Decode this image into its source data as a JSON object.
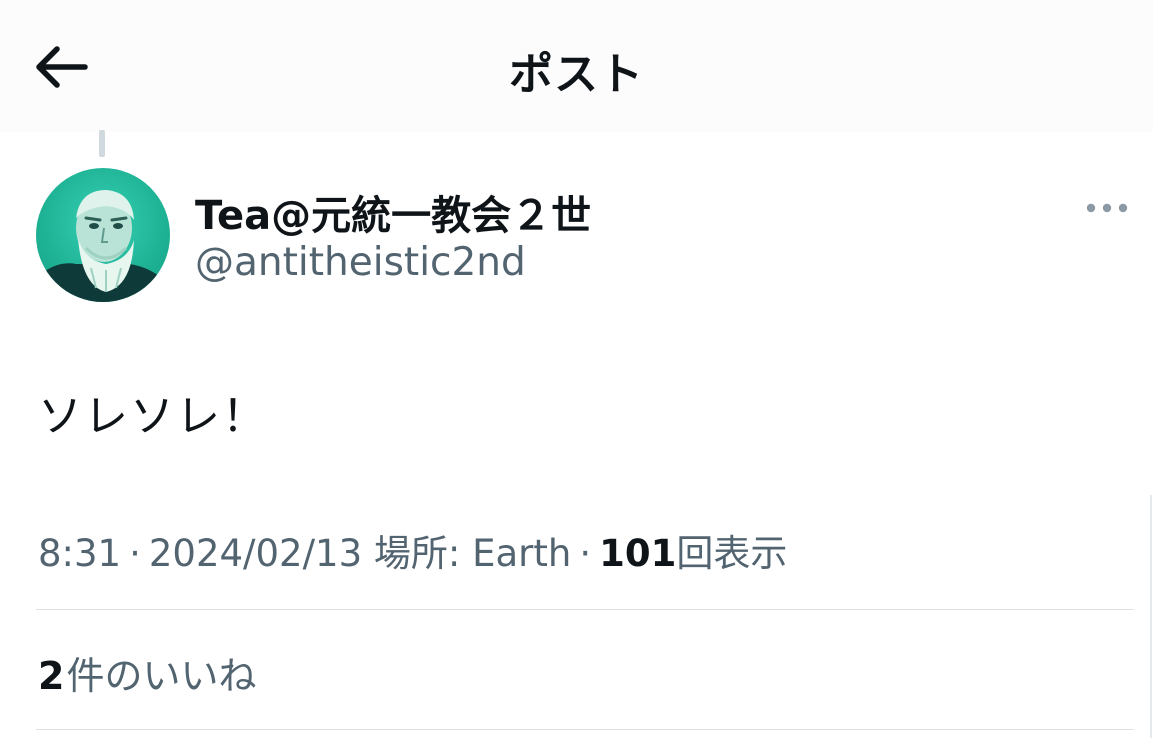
{
  "header": {
    "title": "ポスト",
    "back_icon": "arrow-left-icon"
  },
  "post": {
    "author": {
      "display_name": "Tea@元統一教会２世",
      "handle": "@antitheistic2nd",
      "avatar": "avatar-portrait-teal"
    },
    "more_icon": "more-horizontal-icon",
    "text": "ソレソレ！",
    "meta": {
      "time": "8:31",
      "separator": "·",
      "date": "2024/02/13",
      "location": "場所: Earth",
      "views_count": "101",
      "views_label": "回表示"
    },
    "likes": {
      "count": "2",
      "label": "件のいいね"
    }
  },
  "colors": {
    "text_primary": "#0f1419",
    "text_secondary": "#536471",
    "divider": "#dfe3e6",
    "avatar_bg": "#1fb79a"
  }
}
